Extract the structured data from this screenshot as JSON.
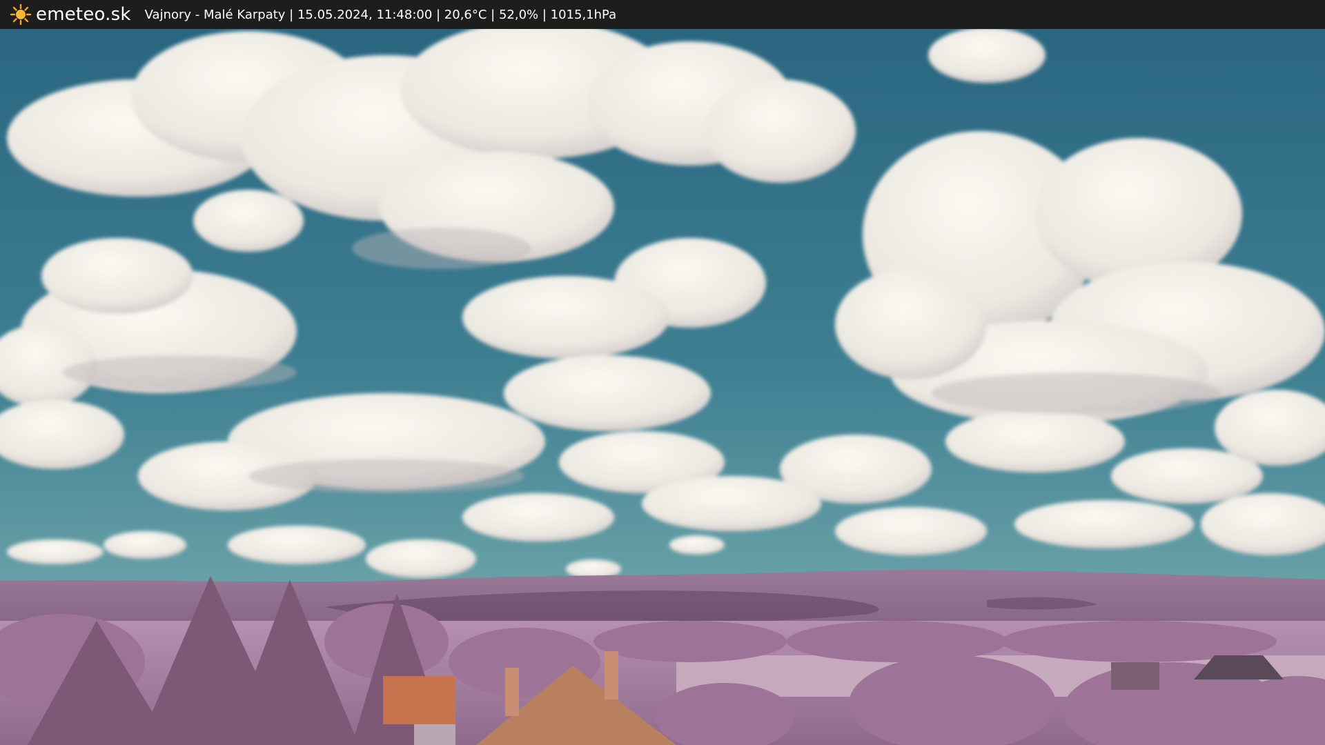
{
  "header": {
    "brand": "emeteo.sk",
    "logo_icon": "sun-icon",
    "caption": "Vajnory - Malé Karpaty | 15.05.2024, 11:48:00 | 20,6°C | 52,0% | 1015,1hPa"
  },
  "colors": {
    "bar": "#1d1d1d",
    "sky_top": "#2a6680",
    "sky_bottom": "#5e98a4",
    "cloud": "#f2efe8",
    "cloud_shade": "#c9c4c4",
    "hills": "#8a6a8a",
    "foliage": "#a77fa3",
    "roof": "#c7734e"
  }
}
